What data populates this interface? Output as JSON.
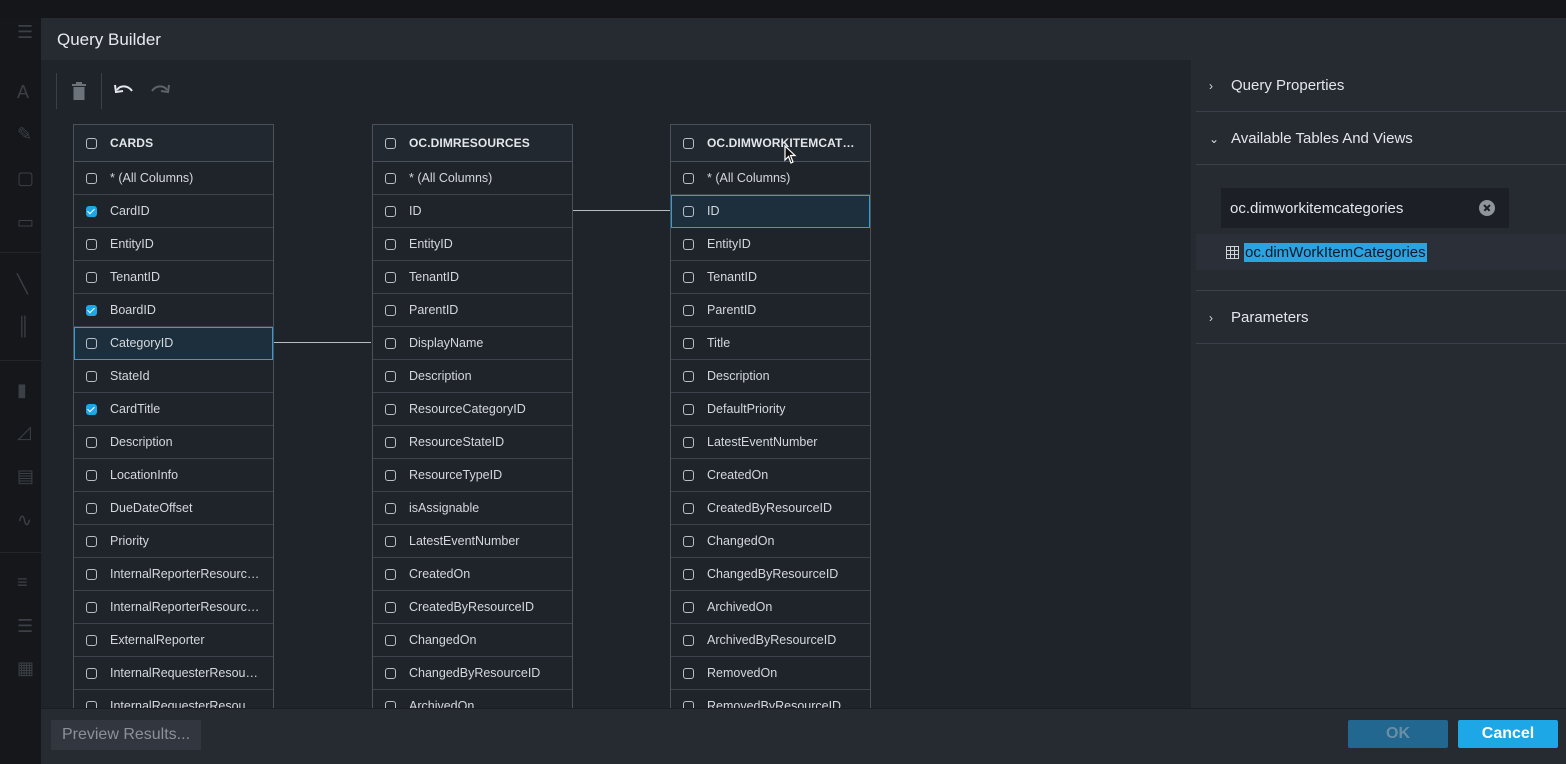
{
  "dialog": {
    "title": "Query Builder"
  },
  "toolbar": {
    "delete_icon": "trash-icon",
    "undo_icon": "undo-icon",
    "redo_icon": "redo-icon"
  },
  "tables": [
    {
      "name": "CARDS",
      "columns": [
        {
          "label": "* (All Columns)",
          "checked": false
        },
        {
          "label": "CardID",
          "checked": true
        },
        {
          "label": "EntityID",
          "checked": false
        },
        {
          "label": "TenantID",
          "checked": false
        },
        {
          "label": "BoardID",
          "checked": true
        },
        {
          "label": "CategoryID",
          "checked": false,
          "selected": true
        },
        {
          "label": "StateId",
          "checked": false
        },
        {
          "label": "CardTitle",
          "checked": true
        },
        {
          "label": "Description",
          "checked": false
        },
        {
          "label": "LocationInfo",
          "checked": false
        },
        {
          "label": "DueDateOffset",
          "checked": false
        },
        {
          "label": "Priority",
          "checked": false
        },
        {
          "label": "InternalReporterResourceID",
          "checked": false
        },
        {
          "label": "InternalReporterResourceC...",
          "checked": false
        },
        {
          "label": "ExternalReporter",
          "checked": false
        },
        {
          "label": "InternalRequesterResource...",
          "checked": false
        },
        {
          "label": "InternalRequesterResource...",
          "checked": false
        }
      ]
    },
    {
      "name": "OC.DIMRESOURCES",
      "columns": [
        {
          "label": "* (All Columns)",
          "checked": false
        },
        {
          "label": "ID",
          "checked": false
        },
        {
          "label": "EntityID",
          "checked": false
        },
        {
          "label": "TenantID",
          "checked": false
        },
        {
          "label": "ParentID",
          "checked": false
        },
        {
          "label": "DisplayName",
          "checked": false
        },
        {
          "label": "Description",
          "checked": false
        },
        {
          "label": "ResourceCategoryID",
          "checked": false
        },
        {
          "label": "ResourceStateID",
          "checked": false
        },
        {
          "label": "ResourceTypeID",
          "checked": false
        },
        {
          "label": "isAssignable",
          "checked": false
        },
        {
          "label": "LatestEventNumber",
          "checked": false
        },
        {
          "label": "CreatedOn",
          "checked": false
        },
        {
          "label": "CreatedByResourceID",
          "checked": false
        },
        {
          "label": "ChangedOn",
          "checked": false
        },
        {
          "label": "ChangedByResourceID",
          "checked": false
        },
        {
          "label": "ArchivedOn",
          "checked": false
        }
      ]
    },
    {
      "name": "OC.DIMWORKITEMCATEGO...",
      "columns": [
        {
          "label": "* (All Columns)",
          "checked": false
        },
        {
          "label": "ID",
          "checked": false,
          "selected": true
        },
        {
          "label": "EntityID",
          "checked": false
        },
        {
          "label": "TenantID",
          "checked": false
        },
        {
          "label": "ParentID",
          "checked": false
        },
        {
          "label": "Title",
          "checked": false
        },
        {
          "label": "Description",
          "checked": false
        },
        {
          "label": "DefaultPriority",
          "checked": false
        },
        {
          "label": "LatestEventNumber",
          "checked": false
        },
        {
          "label": "CreatedOn",
          "checked": false
        },
        {
          "label": "CreatedByResourceID",
          "checked": false
        },
        {
          "label": "ChangedOn",
          "checked": false
        },
        {
          "label": "ChangedByResourceID",
          "checked": false
        },
        {
          "label": "ArchivedOn",
          "checked": false
        },
        {
          "label": "ArchivedByResourceID",
          "checked": false
        },
        {
          "label": "RemovedOn",
          "checked": false
        },
        {
          "label": "RemovedByResourceID",
          "checked": false
        }
      ]
    }
  ],
  "panel": {
    "query_properties": "Query Properties",
    "available_tables": "Available Tables And Views",
    "search_value": "oc.dimworkitemcategories",
    "result": "oc.dimWorkItemCategories",
    "parameters": "Parameters"
  },
  "footer": {
    "preview": "Preview Results...",
    "ok": "OK",
    "cancel": "Cancel"
  },
  "colors": {
    "accent": "#1ea7e6",
    "dialog_bg": "#262b32",
    "canvas_bg": "#1f242b"
  }
}
